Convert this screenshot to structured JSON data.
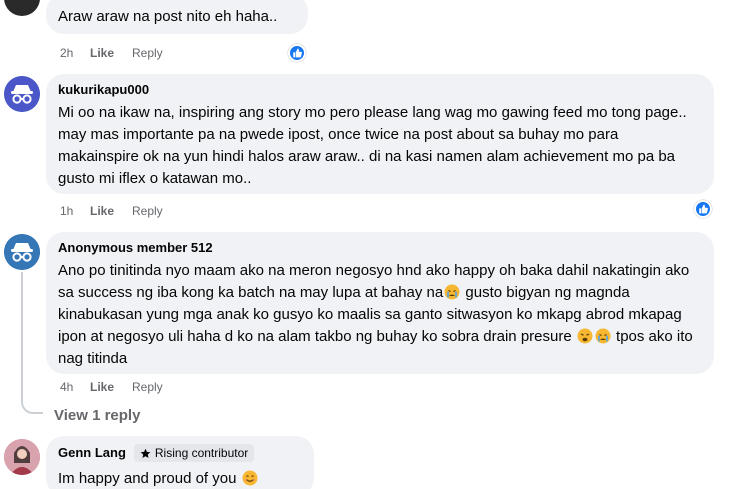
{
  "comments": [
    {
      "text": "Araw araw na post nito eh haha..",
      "time": "2h",
      "like": "Like",
      "reply": "Reply"
    },
    {
      "author": "kukurikapu000",
      "text": "Mi oo na ikaw na, inspiring ang story mo pero please lang wag mo gawing feed mo tong page.. may mas importante pa na pwede ipost, once twice na post about sa buhay mo para makainspire ok na yun hindi halos araw araw.. di na kasi namen alam achievement mo pa ba gusto mi iflex o katawan mo..",
      "time": "1h",
      "like": "Like",
      "reply": "Reply"
    },
    {
      "author": "Anonymous member 512",
      "text_a": "Ano po tinitinda nyo maam ako na meron negosyo hnd ako happy oh baka dahil nakatingin ako sa success ng iba kong ka batch na may lupa at bahay na",
      "text_b": " gusto bigyan ng magnda kinabukasan yung mga anak ko gusyo ko maalis sa ganto sitwasyon ko mkapg abrod mkapag ipon at negosyo uli haha d ko na alam takbo ng buhay ko sobra drain presure ",
      "text_c": " tpos ako ito nag titinda",
      "time": "4h",
      "like": "Like",
      "reply": "Reply",
      "view_replies": "View 1 reply"
    },
    {
      "author": "Genn Lang",
      "badge": "Rising contributor",
      "text": "Im happy and proud of you "
    }
  ],
  "icons": {
    "reaction": "like-reaction-icon",
    "anonymous_avatar": "anonymous-avatar-icon",
    "badge_star": "star-icon",
    "emoji_crying": "crying-face-emoji",
    "emoji_weary": "weary-face-emoji",
    "emoji_smile": "smiling-face-emoji"
  },
  "colors": {
    "bubble_bg": "#f0f2f5",
    "meta_text": "#65676b",
    "like_blue": "#1877f2",
    "anon_avatar": "#3b6cc4"
  }
}
